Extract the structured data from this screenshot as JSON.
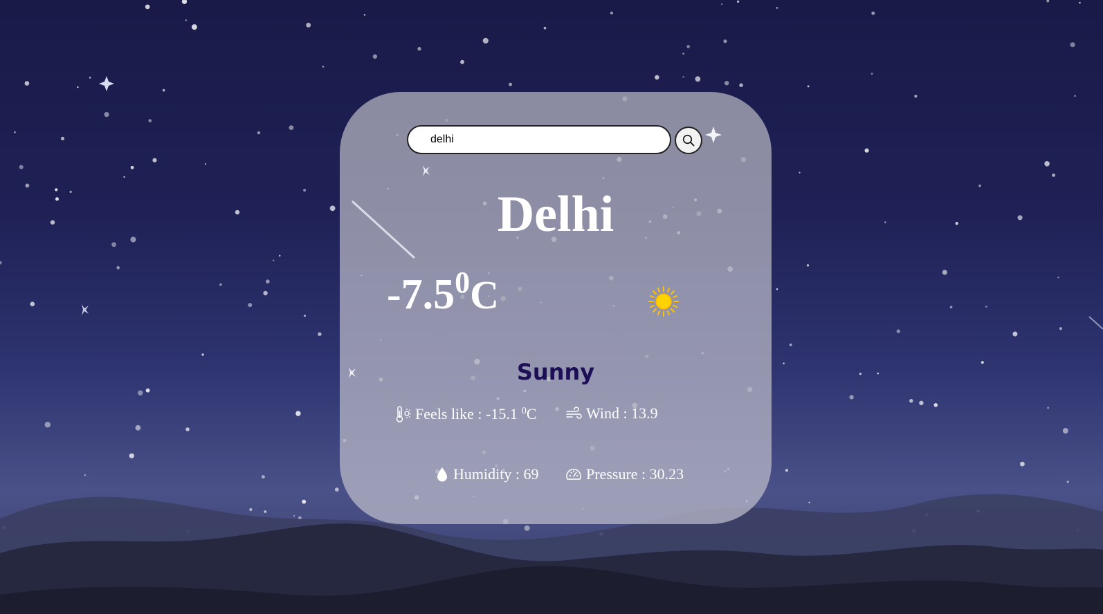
{
  "search": {
    "value": "delhi",
    "placeholder": ""
  },
  "weather": {
    "city": "Delhi",
    "temperature": "-7.5",
    "temp_degree": "0",
    "temp_unit": "C",
    "condition": "Sunny",
    "condition_icon": "sun-icon"
  },
  "stats": {
    "feels_like_label": "Feels like : -15.1",
    "feels_like_degree": "0",
    "feels_like_unit": "C",
    "wind_label": "Wind : 13.9",
    "humidity_label": "Humidity : 69",
    "pressure_label": "Pressure : 30.23"
  },
  "colors": {
    "condition_text": "#1c0f55",
    "sun": "#ffd200"
  }
}
